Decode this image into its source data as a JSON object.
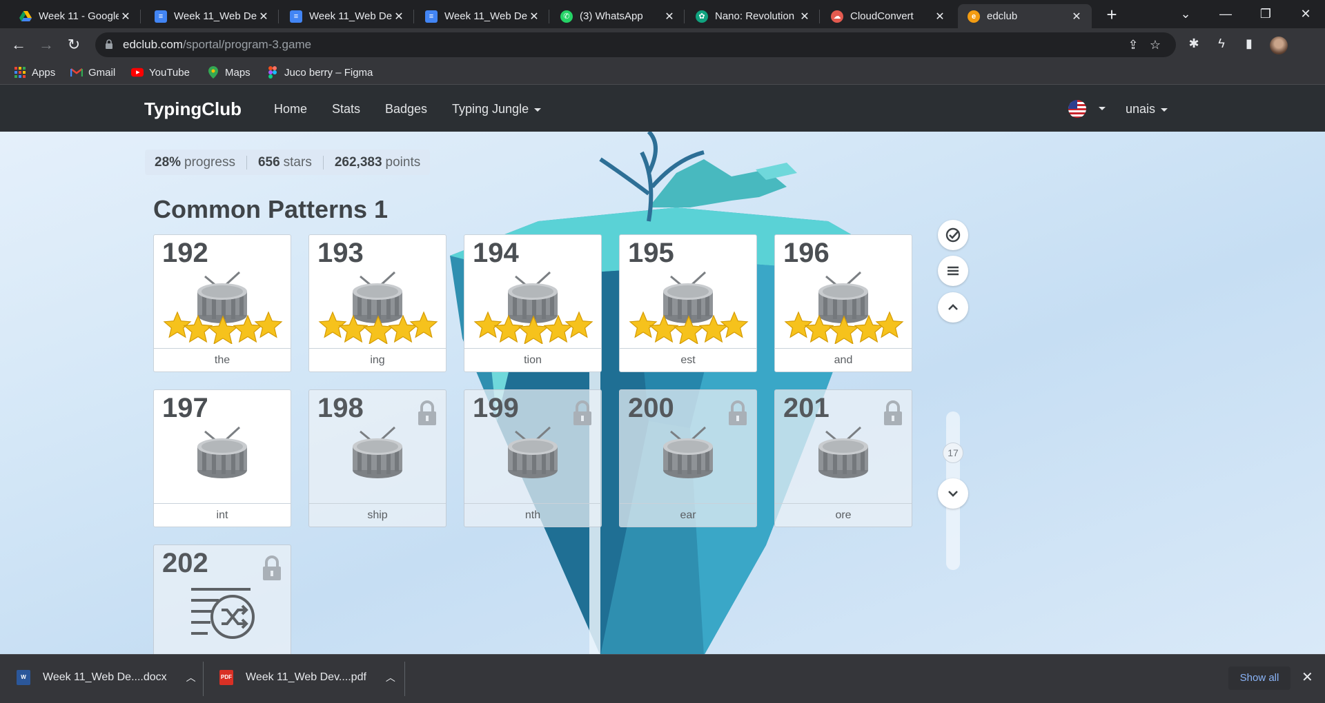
{
  "browser": {
    "tabs": [
      {
        "title": "Week 11 - Google",
        "icon": "google-drive-icon"
      },
      {
        "title": "Week 11_Web De",
        "icon": "google-docs-icon"
      },
      {
        "title": "Week 11_Web De",
        "icon": "google-docs-icon"
      },
      {
        "title": "Week 11_Web De",
        "icon": "google-docs-icon"
      },
      {
        "title": "(3) WhatsApp",
        "icon": "whatsapp-icon"
      },
      {
        "title": "Nano: Revolution",
        "icon": "nano-icon"
      },
      {
        "title": "CloudConvert",
        "icon": "cloudconvert-icon"
      },
      {
        "title": "edclub",
        "icon": "edclub-icon",
        "active": true
      }
    ],
    "url_host": "edclub.com",
    "url_path": "/sportal/program-3.game",
    "bookmarks": [
      {
        "label": "Apps",
        "icon": "apps-grid-icon"
      },
      {
        "label": "Gmail",
        "icon": "gmail-icon"
      },
      {
        "label": "YouTube",
        "icon": "youtube-icon"
      },
      {
        "label": "Maps",
        "icon": "maps-icon"
      },
      {
        "label": "Juco berry – Figma",
        "icon": "figma-icon"
      }
    ]
  },
  "site": {
    "logo": "TypingClub",
    "nav": {
      "home": "Home",
      "stats": "Stats",
      "badges": "Badges",
      "jungle": "Typing Jungle"
    },
    "user": "unais",
    "language_icon": "us-flag-icon"
  },
  "stats": {
    "progress_value": "28%",
    "progress_label": "progress",
    "stars_value": "656",
    "stars_label": "stars",
    "points_value": "262,383",
    "points_label": "points"
  },
  "section_title": "Common Patterns 1",
  "lessons": [
    {
      "num": "192",
      "label": "the",
      "stars": 5,
      "locked": false,
      "icon": "drum-icon"
    },
    {
      "num": "193",
      "label": "ing",
      "stars": 5,
      "locked": false,
      "icon": "drum-icon"
    },
    {
      "num": "194",
      "label": "tion",
      "stars": 5,
      "locked": false,
      "icon": "drum-icon"
    },
    {
      "num": "195",
      "label": "est",
      "stars": 5,
      "locked": false,
      "icon": "drum-icon"
    },
    {
      "num": "196",
      "label": "and",
      "stars": 5,
      "locked": false,
      "icon": "drum-icon"
    },
    {
      "num": "197",
      "label": "int",
      "stars": 0,
      "locked": false,
      "icon": "drum-icon"
    },
    {
      "num": "198",
      "label": "ship",
      "stars": 0,
      "locked": true,
      "icon": "drum-icon"
    },
    {
      "num": "199",
      "label": "nth",
      "stars": 0,
      "locked": true,
      "icon": "drum-icon"
    },
    {
      "num": "200",
      "label": "ear",
      "stars": 0,
      "locked": true,
      "icon": "drum-icon"
    },
    {
      "num": "201",
      "label": "ore",
      "stars": 0,
      "locked": true,
      "icon": "drum-icon"
    },
    {
      "num": "202",
      "label": "",
      "stars": 0,
      "locked": true,
      "icon": "shuffle-list-icon"
    }
  ],
  "side_controls": {
    "scroll_position": "17"
  },
  "downloads": {
    "items": [
      {
        "name": "Week 11_Web De....docx",
        "icon": "word-doc-icon"
      },
      {
        "name": "Week 11_Web Dev....pdf",
        "icon": "pdf-icon"
      }
    ],
    "show_all": "Show all"
  },
  "colors": {
    "header_bg": "#2b2f33",
    "star": "#f6c21c",
    "chrome_bg": "#202124"
  }
}
